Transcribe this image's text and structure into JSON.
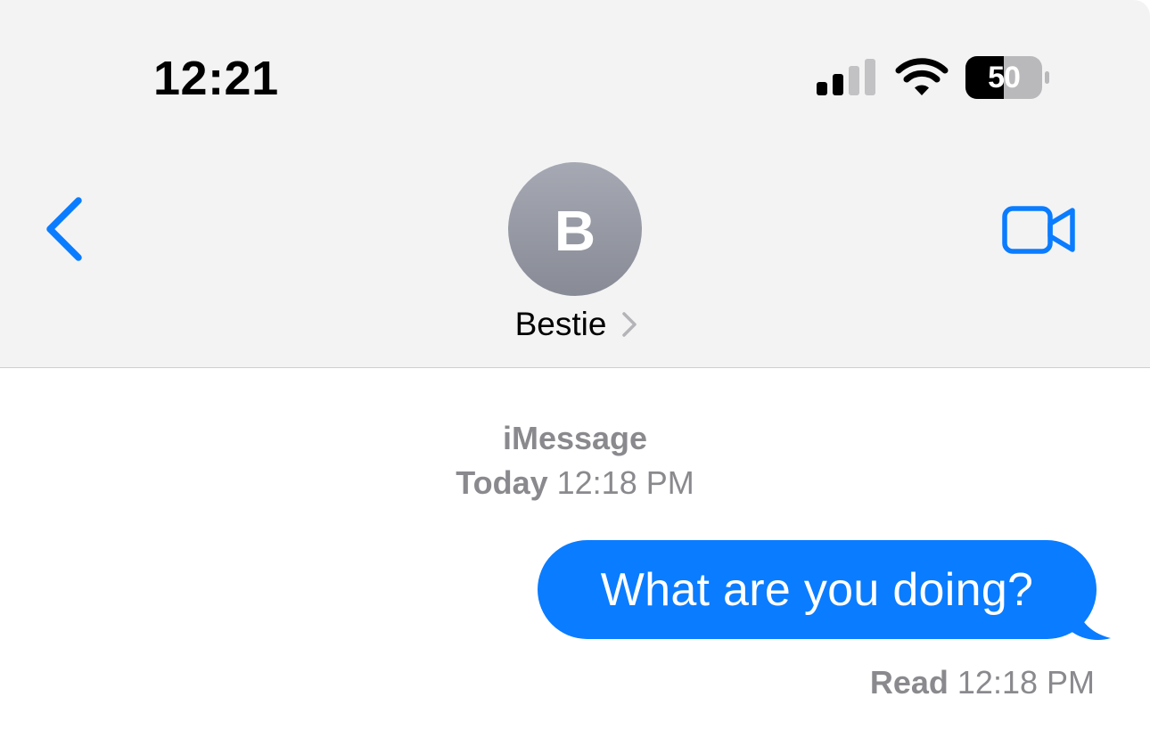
{
  "status_bar": {
    "time": "12:21",
    "battery_level": "50",
    "signal_icon": "cellular-signal-icon",
    "wifi_icon": "wifi-icon",
    "battery_icon": "battery-icon"
  },
  "nav": {
    "back_icon": "chevron-left-icon",
    "contact_initial": "B",
    "contact_name": "Bestie",
    "contact_chevron_icon": "chevron-right-icon",
    "video_icon": "video-camera-icon"
  },
  "conversation": {
    "service": "iMessage",
    "timestamp_day": "Today",
    "timestamp_time": "12:18 PM",
    "messages": [
      {
        "direction": "outgoing",
        "text": "What are you doing?"
      }
    ],
    "receipt_status": "Read",
    "receipt_time": "12:18 PM"
  },
  "colors": {
    "accent": "#0a7cff",
    "header_bg": "#f3f3f4",
    "secondary_text": "#8a8a8e",
    "avatar_bg": "#9a9da6"
  }
}
